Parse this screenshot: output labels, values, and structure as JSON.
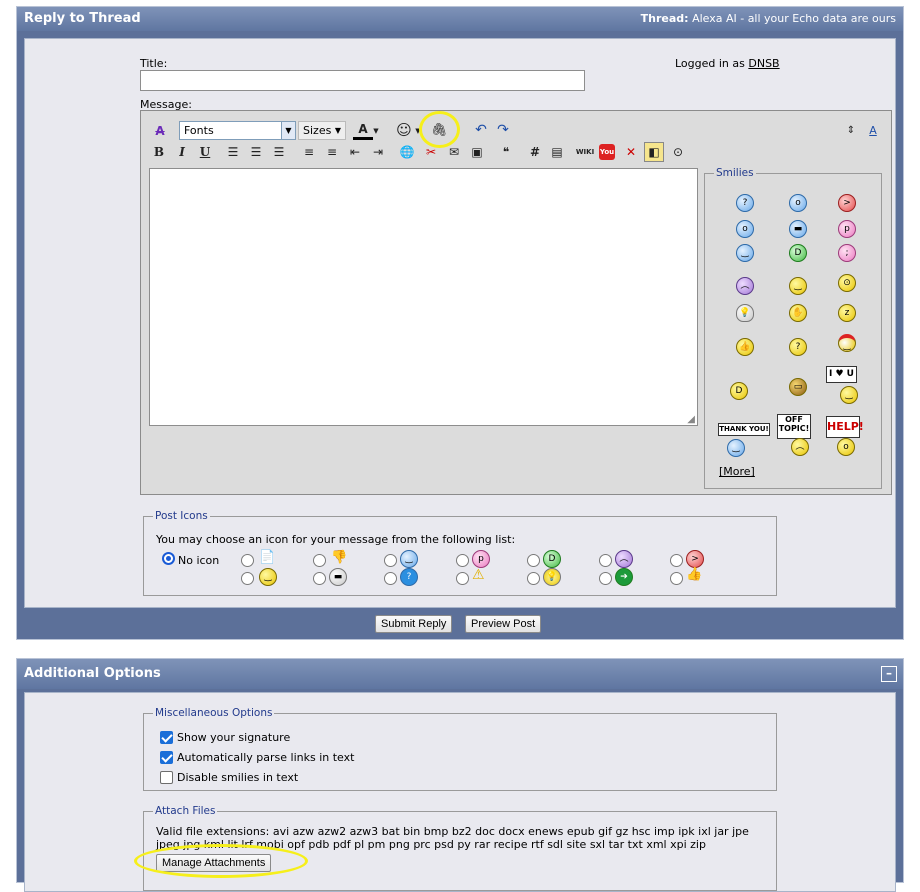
{
  "reply_panel": {
    "title": "Reply to Thread",
    "thread_label": "Thread:",
    "thread_title": "Alexa AI - all your Echo data are ours"
  },
  "form": {
    "title_label": "Title:",
    "title_value": "",
    "logged_in_text": "Logged in as",
    "username": "DNSB",
    "message_label": "Message:"
  },
  "toolbar": {
    "font_select": "Fonts",
    "size_select": "Sizes",
    "icons": [
      "remove-format-icon",
      "font-color-icon",
      "smilies-icon",
      "attachment-icon",
      "undo-icon",
      "redo-icon",
      "resize-icon",
      "switch-mode-icon",
      "bold-icon",
      "italic-icon",
      "underline-icon",
      "align-left-icon",
      "align-center-icon",
      "align-right-icon",
      "ordered-list-icon",
      "unordered-list-icon",
      "outdent-icon",
      "indent-icon",
      "insert-link-icon",
      "unlink-icon",
      "email-icon",
      "insert-image-icon",
      "quote-icon",
      "hashtag-icon",
      "video-icon",
      "wiki-icon",
      "youtube-icon",
      "spoiler-icon",
      "highlight-icon",
      "binoculars-icon"
    ],
    "bold": "B",
    "italic": "I",
    "underline": "U",
    "wiki": "WIKI",
    "youtube": "You",
    "hashtag": "#"
  },
  "smilies": {
    "legend": "Smilies",
    "more": "[More]",
    "signs": [
      "I ♥ U",
      "THANK YOU!",
      "OFF TOPIC!",
      "HELP!"
    ]
  },
  "post_icons": {
    "legend": "Post Icons",
    "instruction": "You may choose an icon for your message from the following list:",
    "no_icon": "No icon"
  },
  "actions": {
    "submit": "Submit Reply",
    "preview": "Preview Post"
  },
  "additional": {
    "title": "Additional Options",
    "collapse": "–",
    "misc_legend": "Miscellaneous Options",
    "options": [
      {
        "label": "Show your signature",
        "checked": true
      },
      {
        "label": "Automatically parse links in text",
        "checked": true
      },
      {
        "label": "Disable smilies in text",
        "checked": false
      }
    ],
    "attach_legend": "Attach Files",
    "valid_label": "Valid file extensions:",
    "extensions_line1": "avi azw azw2 azw3 bat bin bmp bz2 doc docx enews epub gif gz hsc imp ipk ixl jar jpe",
    "extensions_line2": "jpeg jpg kml lit lrf mobi opf pdb pdf pl pm png prc psd py rar recipe rtf sdl site sxl tar txt xml xpi zip",
    "manage_button": "Manage Attachments"
  },
  "colors": {
    "header": "#5f76a1",
    "highlight": "#f6ef1a",
    "legend_text": "#223a8c"
  }
}
